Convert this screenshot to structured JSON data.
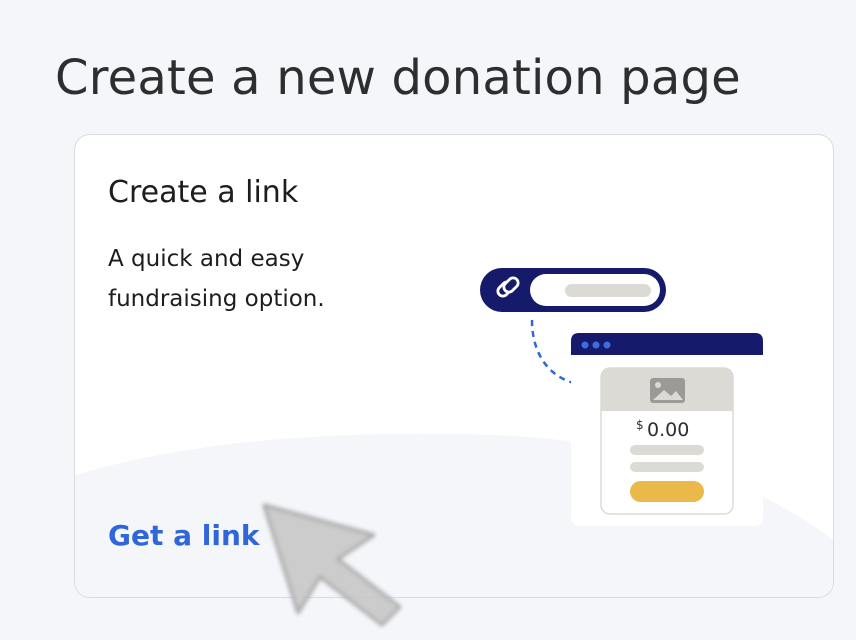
{
  "page": {
    "title": "Create a new donation page"
  },
  "card": {
    "title": "Create a link",
    "description": "A quick and easy fundraising option.",
    "link_label": "Get a link",
    "illustration": {
      "link_icon": "link-icon",
      "image_icon": "image-icon",
      "currency_symbol": "$",
      "amount": "0.00"
    }
  },
  "colors": {
    "link_blue": "#2f66d8",
    "navy": "#151a6a",
    "gold": "#ebb84a",
    "placeholder_gray": "#dcdad4"
  }
}
